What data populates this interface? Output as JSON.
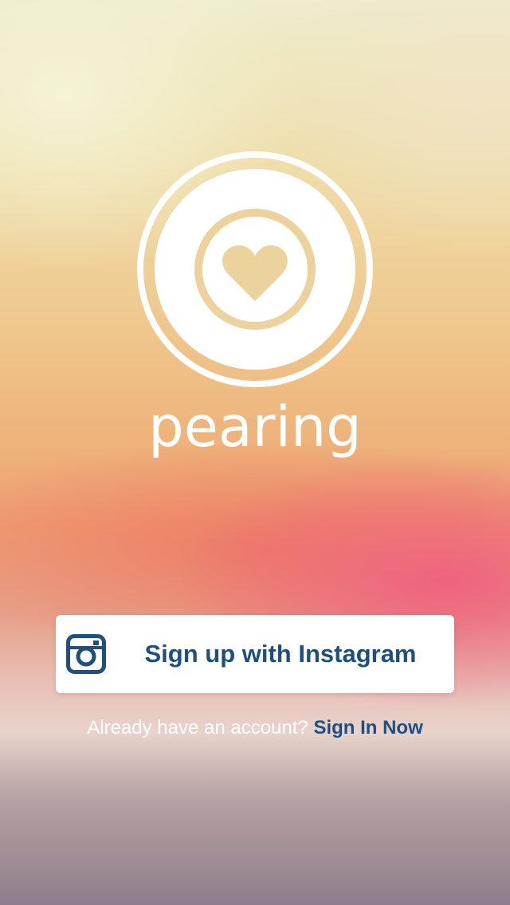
{
  "app": {
    "brand_name": "pearing",
    "logo_icon": "heart-in-circle-icon"
  },
  "signup": {
    "button_label": "Sign up with Instagram",
    "icon": "instagram-icon"
  },
  "signin": {
    "prompt": "Already have an account?",
    "link_label": "Sign In Now"
  },
  "colors": {
    "accent_blue": "#1f4f7e",
    "logo_tan": "#ecd39d",
    "white": "#ffffff"
  }
}
